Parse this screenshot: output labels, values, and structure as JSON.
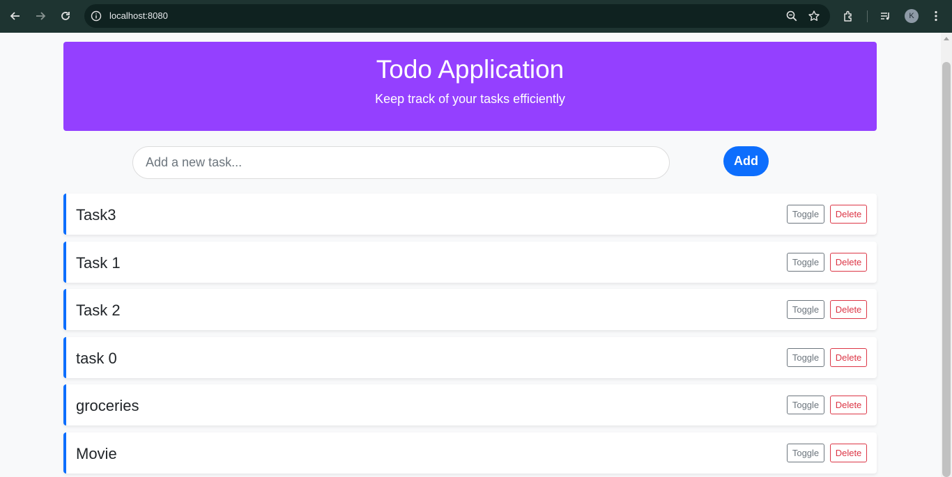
{
  "browser": {
    "url": "localhost:8080",
    "avatar_initial": "K",
    "icons": [
      "back-arrow-icon",
      "forward-arrow-icon",
      "reload-icon",
      "info-icon",
      "zoom-icon",
      "star-icon",
      "extensions-icon",
      "media-control-icon",
      "menu-dots-icon"
    ]
  },
  "header": {
    "title": "Todo Application",
    "subtitle": "Keep track of your tasks efficiently"
  },
  "new_task": {
    "placeholder": "Add a new task...",
    "value": "",
    "add_label": "Add"
  },
  "tasks": [
    {
      "label": "Task3",
      "toggle": "Toggle",
      "delete": "Delete"
    },
    {
      "label": "Task 1",
      "toggle": "Toggle",
      "delete": "Delete"
    },
    {
      "label": "Task 2",
      "toggle": "Toggle",
      "delete": "Delete"
    },
    {
      "label": "task 0",
      "toggle": "Toggle",
      "delete": "Delete"
    },
    {
      "label": "groceries",
      "toggle": "Toggle",
      "delete": "Delete"
    },
    {
      "label": "Movie",
      "toggle": "Toggle",
      "delete": "Delete"
    }
  ],
  "colors": {
    "header_bg": "#9440ff",
    "accent": "#0d6efd",
    "danger": "#dc3545",
    "secondary": "#6c757d"
  }
}
